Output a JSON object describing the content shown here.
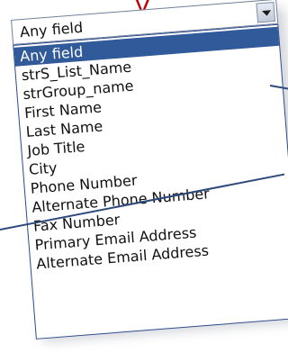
{
  "select": {
    "value": "Any field",
    "options": [
      "Any field",
      "strS_List_Name",
      "strGroup_name",
      "First Name",
      "Last Name",
      "Job Title",
      "City",
      "Phone Number",
      "Alternate Phone Number",
      "Fax Number",
      "Primary Email Address",
      "Alternate Email Address"
    ],
    "highlighted_index": 0
  },
  "colors": {
    "highlight": "#315a9a",
    "border": "#2b4a8a",
    "callout": "#2d4a7a"
  }
}
